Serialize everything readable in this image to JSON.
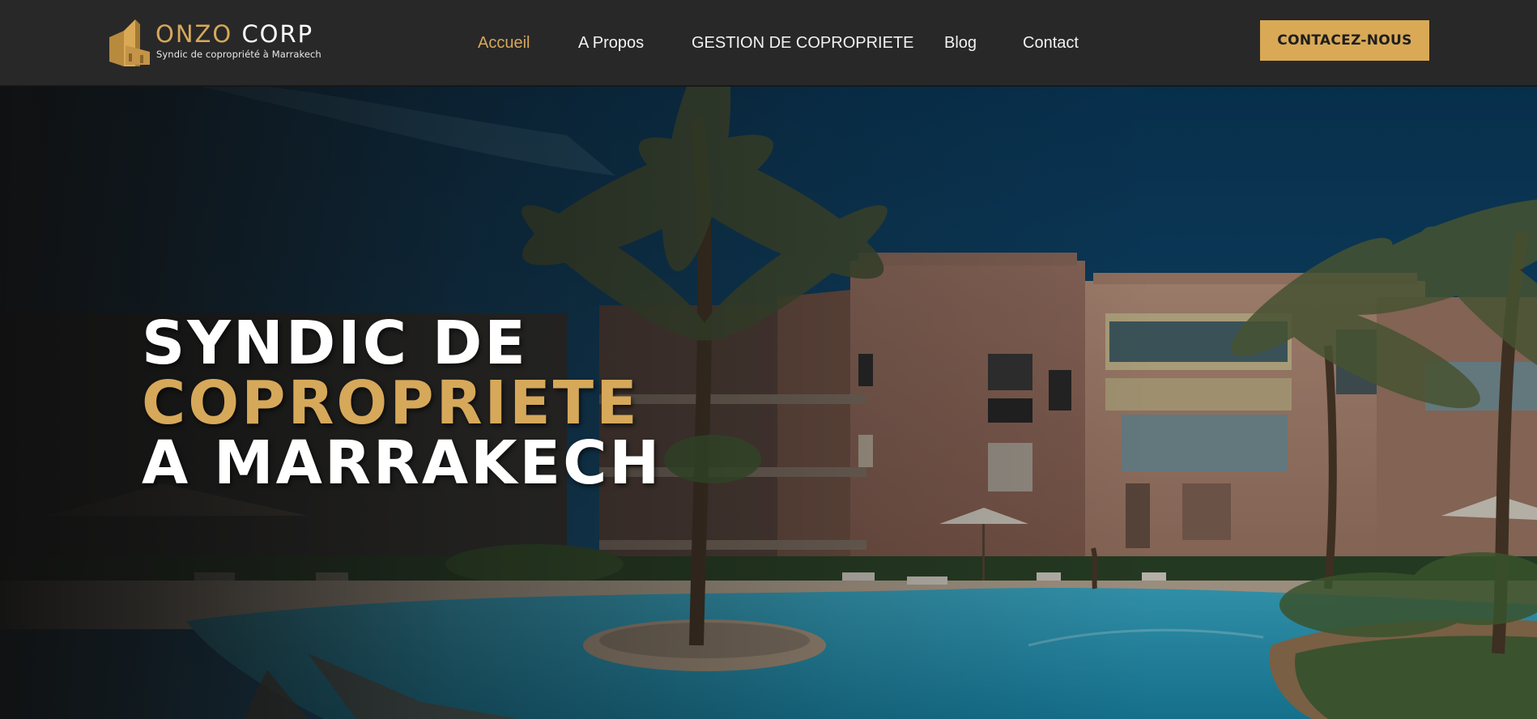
{
  "header": {
    "logo": {
      "brand_part1": "ONZO",
      "brand_part2": "CORP",
      "tagline": "Syndic de copropriété à Marrakech",
      "icon": "building-logo-icon"
    },
    "nav": [
      {
        "label": "Accueil",
        "active": true
      },
      {
        "label": "A Propos",
        "active": false
      },
      {
        "label": "GESTION DE COPROPRIETE",
        "active": false
      },
      {
        "label": "Blog",
        "active": false
      },
      {
        "label": "Contact",
        "active": false
      }
    ],
    "cta_label": "CONTACEZ-NOUS"
  },
  "hero": {
    "title_line1": "SYNDIC DE",
    "title_line2": "COPROPRIETE",
    "title_line3": "A MARRAKECH",
    "background": "residence-pool-palm-trees-photo"
  },
  "colors": {
    "accent": "#d6a85a",
    "header_bg": "#282828",
    "cta_bg": "#d9a956",
    "text_light": "#ffffff"
  }
}
